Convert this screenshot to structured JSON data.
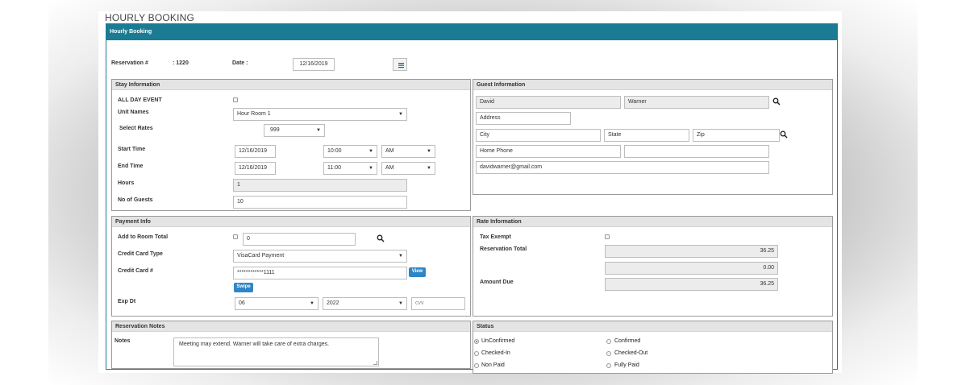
{
  "page": {
    "title": "HOURLY BOOKING",
    "panel_title": "Hourly Booking"
  },
  "reservation": {
    "number_label": "Reservation #",
    "number_value": ": 1220",
    "date_label": "Date :",
    "date_value": "12/16/2019"
  },
  "stay": {
    "title": "Stay Information",
    "all_day_label": "ALL DAY EVENT",
    "unit_label": "Unit Names",
    "unit_value": "Hour Room 1",
    "rates_label": "Select Rates",
    "rates_value": "999",
    "start_label": "Start Time",
    "start_date": "12/16/2019",
    "start_time": "10:00",
    "start_ampm": "AM",
    "end_label": "End Time",
    "end_date": "12/16/2019",
    "end_time": "11:00",
    "end_ampm": "AM",
    "hours_label": "Hours",
    "hours_value": "1",
    "guests_label": "No of Guests",
    "guests_value": "10"
  },
  "guest": {
    "title": "Guest Information",
    "first_name": "David",
    "last_name": "Warner",
    "address_placeholder": "Address",
    "city_placeholder": "City",
    "state_placeholder": "State",
    "zip_placeholder": "Zip",
    "phone_placeholder": "Home Phone",
    "phone2": "",
    "email": "davidwarner@gmail.com"
  },
  "payment": {
    "title": "Payment Info",
    "add_to_room_label": "Add to Room Total",
    "add_to_room_value": "0",
    "cc_type_label": "Credit Card Type",
    "cc_type_value": "VisaCard Payment",
    "cc_number_label": "Credit Card #",
    "cc_number_value": "************1111",
    "view_label": "View",
    "swipe_label": "Swipe",
    "exp_label": "Exp Dt",
    "exp_month": "06",
    "exp_year": "2022",
    "cvv_placeholder": "cvv"
  },
  "rate": {
    "title": "Rate Information",
    "tax_exempt_label": "Tax Exempt",
    "res_total_label": "Reservation Total",
    "res_total_value": "36.25",
    "second_value": "0.00",
    "amount_due_label": "Amount Due",
    "amount_due_value": "36.25"
  },
  "notes": {
    "title": "Reservation Notes",
    "label": "Notes",
    "value": "Meeting may extend. Warner will take care of extra charges."
  },
  "status": {
    "title": "Status",
    "options": [
      "UnConfirmed",
      "Confirmed",
      "Checked-In",
      "Checked-Out",
      "Non Paid",
      "Fully Paid"
    ],
    "selected": "UnConfirmed"
  }
}
